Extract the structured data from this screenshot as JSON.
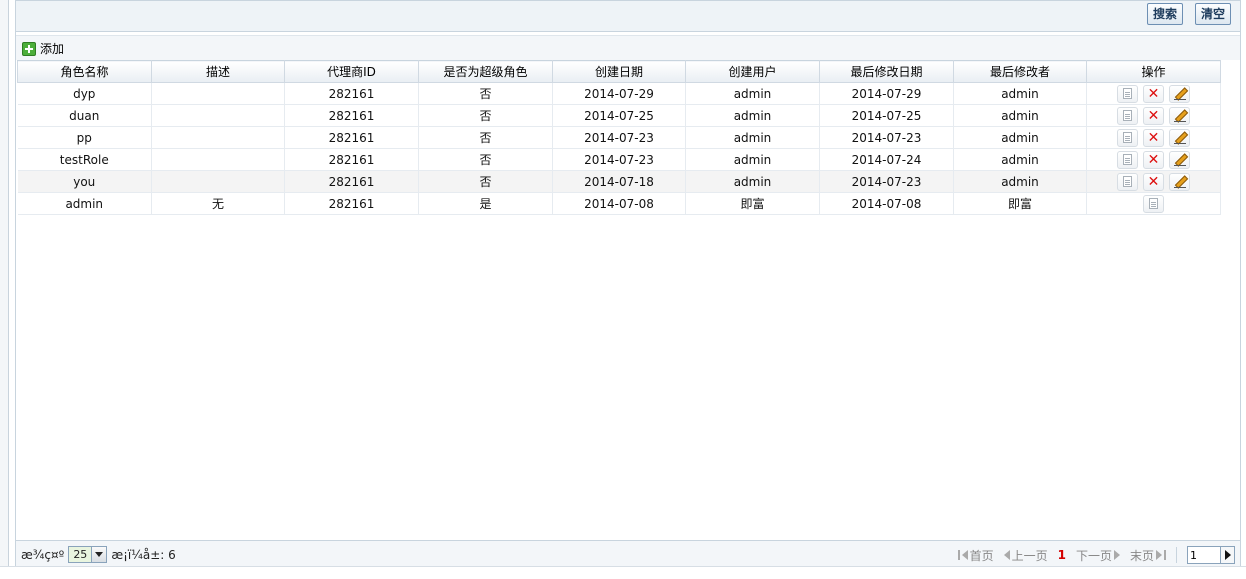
{
  "top": {
    "search_label": "搜索",
    "clear_label": "清空"
  },
  "toolbar": {
    "add_label": "添加",
    "add_icon": "add-icon"
  },
  "table": {
    "columns": [
      "角色名称",
      "描述",
      "代理商ID",
      "是否为超级角色",
      "创建日期",
      "创建用户",
      "最后修改日期",
      "最后修改者",
      "操作"
    ],
    "rows": [
      [
        "dyp",
        "",
        "282161",
        "否",
        "2014-07-29",
        "admin",
        "2014-07-29",
        "admin"
      ],
      [
        "duan",
        "",
        "282161",
        "否",
        "2014-07-25",
        "admin",
        "2014-07-25",
        "admin"
      ],
      [
        "pp",
        "",
        "282161",
        "否",
        "2014-07-23",
        "admin",
        "2014-07-23",
        "admin"
      ],
      [
        "testRole",
        "",
        "282161",
        "否",
        "2014-07-23",
        "admin",
        "2014-07-24",
        "admin"
      ],
      [
        "you",
        "",
        "282161",
        "否",
        "2014-07-18",
        "admin",
        "2014-07-23",
        "admin"
      ],
      [
        "admin",
        "无",
        "282161",
        "是",
        "2014-07-08",
        "即富",
        "2014-07-08",
        "即富"
      ]
    ],
    "row_actions": [
      [
        "view",
        "delete",
        "edit"
      ],
      [
        "view",
        "delete",
        "edit"
      ],
      [
        "view",
        "delete",
        "edit"
      ],
      [
        "view",
        "delete",
        "edit"
      ],
      [
        "view",
        "delete",
        "edit"
      ],
      [
        "view"
      ]
    ]
  },
  "footer": {
    "page_size_prefix": "æ¾ç¤º",
    "page_size": "25",
    "total_prefix": "æ¡ï¼å±: 6",
    "first_label": "首页",
    "prev_label": "上一页",
    "current_page": "1",
    "next_label": "下一页",
    "last_label": "末页",
    "goto_value": "1"
  },
  "colors": {
    "accent": "#6d8fb3",
    "delete": "#dd1111",
    "current_page": "#d40000"
  }
}
